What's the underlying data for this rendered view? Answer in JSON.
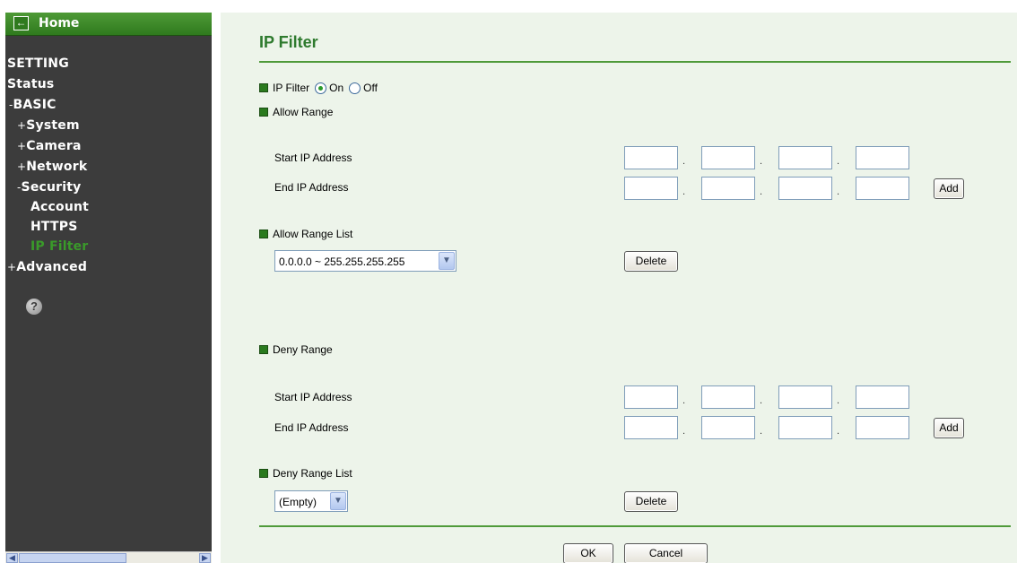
{
  "sidebar": {
    "home_label": "Home",
    "setting_label": "SETTING",
    "status_label": "Status",
    "basic_label": "BASIC",
    "system_label": "System",
    "camera_label": "Camera",
    "network_label": "Network",
    "security_label": "Security",
    "account_label": "Account",
    "https_label": "HTTPS",
    "ipfilter_label": "IP Filter",
    "advanced_label": "Advanced",
    "minus_sign": "-",
    "plus_sign": "+",
    "help_symbol": "?",
    "home_icon": "arrow-left-icon",
    "active_color": "#3a9a2a"
  },
  "page": {
    "title": "IP Filter",
    "ip_filter_label": "IP Filter",
    "on_label": "On",
    "off_label": "Off",
    "allow_range_label": "Allow Range",
    "start_ip_label": "Start IP Address",
    "end_ip_label": "End IP Address",
    "add_label": "Add",
    "allow_range_list_label": "Allow Range List",
    "allow_range_selected": "0.0.0.0 ~ 255.255.255.255",
    "delete_label": "Delete",
    "deny_range_label": "Deny Range",
    "deny_range_list_label": "Deny Range List",
    "deny_range_selected": "(Empty)",
    "ok_label": "OK",
    "cancel_label": "Cancel",
    "dot": "."
  },
  "colors": {
    "accent_green": "#2e7a2e",
    "sidebar_bg": "#3c3c3c",
    "panel_bg": "#edf4ea"
  }
}
